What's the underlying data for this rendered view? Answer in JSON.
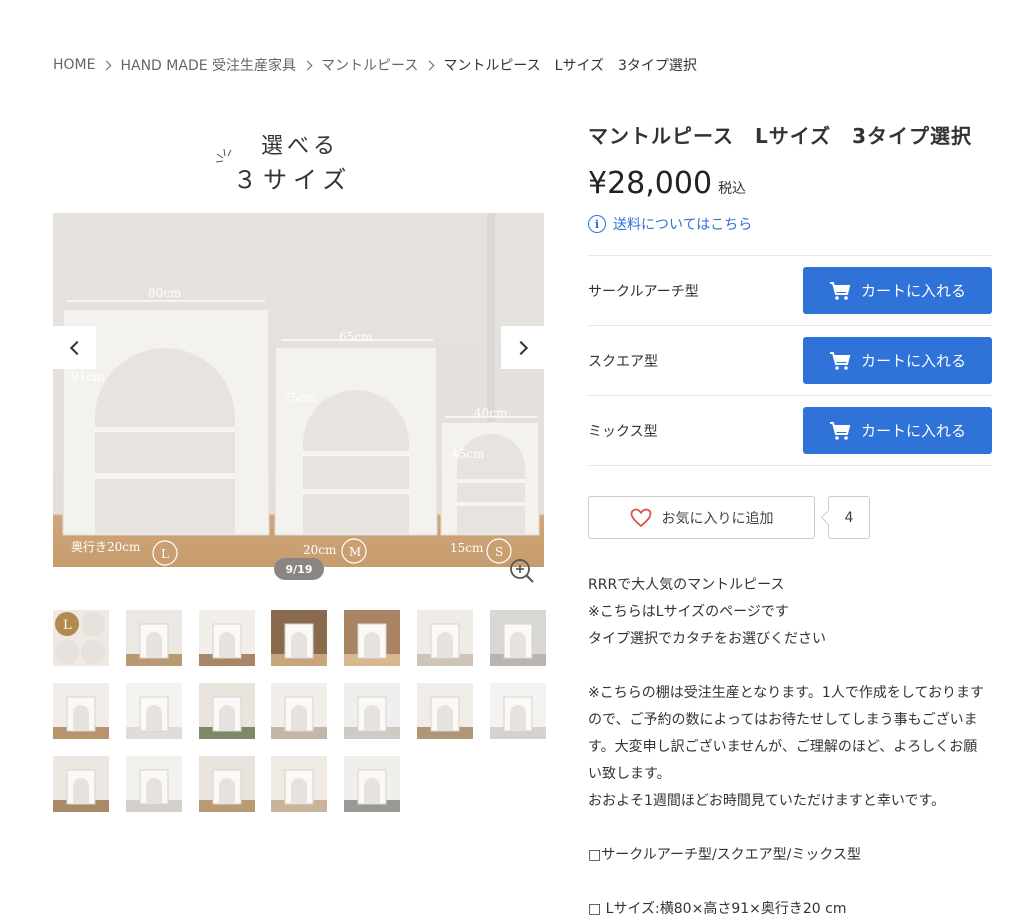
{
  "breadcrumb": [
    {
      "label": "HOME"
    },
    {
      "label": "HAND MADE 受注生産家具"
    },
    {
      "label": "マントルピース"
    },
    {
      "label": "マントルピース　Lサイズ　3タイプ選択"
    }
  ],
  "hero": {
    "line1": "選べる",
    "line2": "３サイズ"
  },
  "gallery": {
    "counter": "9/19",
    "main_image_labels": {
      "l_width": "80cm",
      "l_height": "91cm",
      "l_depth": "奥行き20cm",
      "l_badge": "L",
      "m_width": "65cm",
      "m_height": "75cm",
      "m_depth": "20cm",
      "m_badge": "M",
      "s_width": "40cm",
      "s_height": "45cm",
      "s_depth": "15cm",
      "s_badge": "S"
    },
    "thumb_count": 19,
    "first_thumb_label": "L"
  },
  "product": {
    "title": "マントルピース　Lサイズ　3タイプ選択",
    "price": "¥28,000",
    "tax_label": "税込",
    "shipping_link": "送料についてはこちら",
    "variants": [
      {
        "name": "サークルアーチ型",
        "button": "カートに入れる"
      },
      {
        "name": "スクエア型",
        "button": "カートに入れる"
      },
      {
        "name": "ミックス型",
        "button": "カートに入れる"
      }
    ],
    "favorite_label": "お気に入りに追加",
    "favorite_count": "4"
  },
  "description": [
    "RRRで大人気のマントルピース",
    "※こちらはLサイズのページです",
    "タイプ選択でカタチをお選びください",
    "",
    "※こちらの棚は受注生産となります。1人で作成をしておりますので、ご予約の数によってはお待たせしてしまう事もございます。大変申し訳ございませんが、ご理解のほど、よろしくお願い致します。",
    "おおよそ1週間ほどお時間見ていただけますと幸いです。",
    "",
    "□サークルアーチ型/スクエア型/ミックス型",
    "",
    "□ Lサイズ:横80×高さ91×奥行き20 cm"
  ],
  "colors": {
    "accent": "#2f72d8",
    "text": "#333333",
    "border": "#e6e6e6"
  }
}
